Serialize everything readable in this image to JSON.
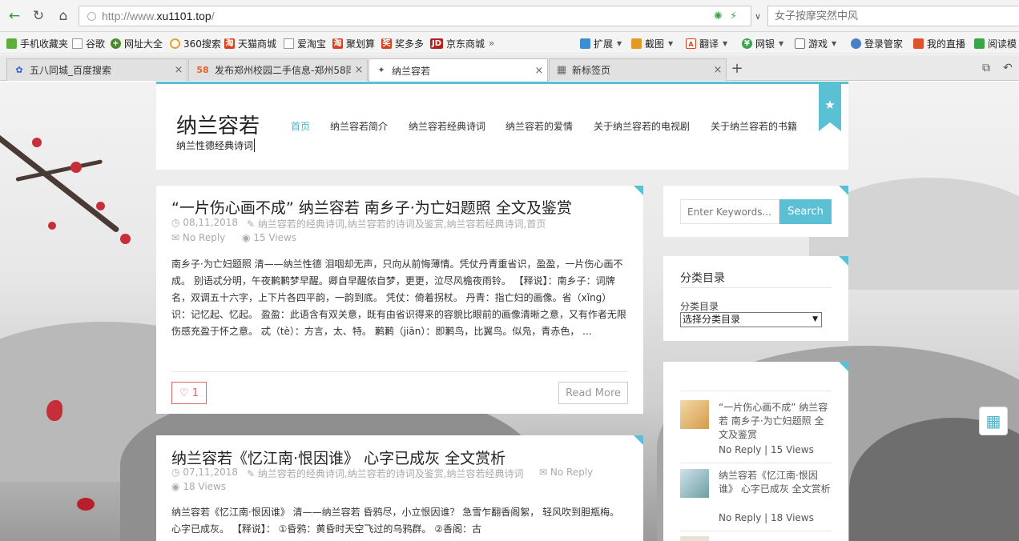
{
  "browser": {
    "url_prefix": "http://www.",
    "url_domain": "xu1101.top",
    "url_suffix": "/",
    "search_placeholder": "女子按摩突然中风",
    "bookmarks": [
      {
        "label": "手机收藏夹"
      },
      {
        "label": "谷歌"
      },
      {
        "label": "网址大全"
      },
      {
        "label": "360搜索"
      },
      {
        "label": "天猫商城"
      },
      {
        "label": "爱淘宝"
      },
      {
        "label": "聚划算"
      },
      {
        "label": "奖多多"
      },
      {
        "label": "京东商城"
      }
    ],
    "bookmark_more": "»",
    "tools": [
      {
        "label": "扩展"
      },
      {
        "label": "截图"
      },
      {
        "label": "翻译"
      },
      {
        "label": "网银"
      },
      {
        "label": "游戏"
      },
      {
        "label": "登录管家"
      },
      {
        "label": "我的直播"
      },
      {
        "label": "阅读模"
      }
    ],
    "tabs": [
      {
        "label": "五八同城_百度搜索",
        "icon": "paw-icon",
        "active": false
      },
      {
        "label": "发布郑州校园二手信息-郑州58同城",
        "icon": "58-icon",
        "active": false
      },
      {
        "label": "纳兰容若",
        "icon": "site-icon",
        "active": true
      },
      {
        "label": "新标签页",
        "icon": "grid-icon",
        "active": false
      }
    ],
    "tab_close": "×",
    "tab_new": "+"
  },
  "site": {
    "title": "纳兰容若",
    "subtitle": "纳兰性德经典诗词",
    "menu": [
      "首页",
      "纳兰容若简介",
      "纳兰容若经典诗词",
      "纳兰容若的爱情",
      "关于纳兰容若的电视剧",
      "关于纳兰容若的书籍"
    ],
    "accent": "#5bc0d4"
  },
  "posts": [
    {
      "title": "“一片伤心画不成” 纳兰容若 南乡子·为亡妇题照 全文及鉴赏",
      "date": "08,11,2018",
      "categories": "纳兰容若的经典诗词,纳兰容若的诗词及鉴赏,纳兰容若经典诗词,首页",
      "reply": "No Reply",
      "views": "15 Views",
      "excerpt": "南乡子·为亡妇题照 清——纳兰性德 泪咽却无声，只向从前悔薄情。凭仗丹青重省识，盈盈，一片伤心画不成。 别语忒分明，午夜鹣鹣梦早醒。卿自早醒侬自梦，更更，泣尽风檐夜雨铃。 【释说】：南乡子：词牌名，双调五十六字，上下片各四平韵，一韵到底。 凭仗：倚着拐杖。 丹青：指亡妇的画像。省（xǐng）识：记忆起、忆起。 盈盈：此语含有双关意，既有由省识得来的容貌比眼前的画像清晰之意，又有作者无限伤感充盈于怀之意。 忒（tè）：方言，太、特。 鹣鹣（jiān）：即鹣鸟，比翼鸟。似凫，青赤色， ...",
      "likes": "1",
      "read_more": "Read More"
    },
    {
      "title": "纳兰容若《忆江南·恨因谁》 心字已成灰 全文赏析",
      "date": "07,11,2018",
      "categories": "纳兰容若的经典诗词,纳兰容若的诗词及鉴赏,纳兰容若经典诗词",
      "reply": "No Reply",
      "views": "18 Views",
      "excerpt": "纳兰容若《忆江南·恨因谁》 清——纳兰容若 昏鸦尽，小立恨因谁？ 急雪乍翻香阁絮， 轻风吹到胆瓶梅。心字已成灰。 【释说】： ①昏鸦：黄昏时天空飞过的乌鸦群。 ②香阁：古"
    }
  ],
  "sidebar": {
    "search_placeholder": "Enter Keywords...",
    "search_button": "Search",
    "category_title": "分类目录",
    "category_label": "分类目录",
    "category_select": "选择分类目录",
    "recent": [
      {
        "title": "“一片伤心画不成” 纳兰容若 南乡子·为亡妇题照 全文及鉴赏",
        "meta": "No Reply | 15 Views"
      },
      {
        "title": "纳兰容若《忆江南·恨因谁》 心字已成灰 全文赏析",
        "meta": "No Reply | 18 Views"
      }
    ]
  }
}
